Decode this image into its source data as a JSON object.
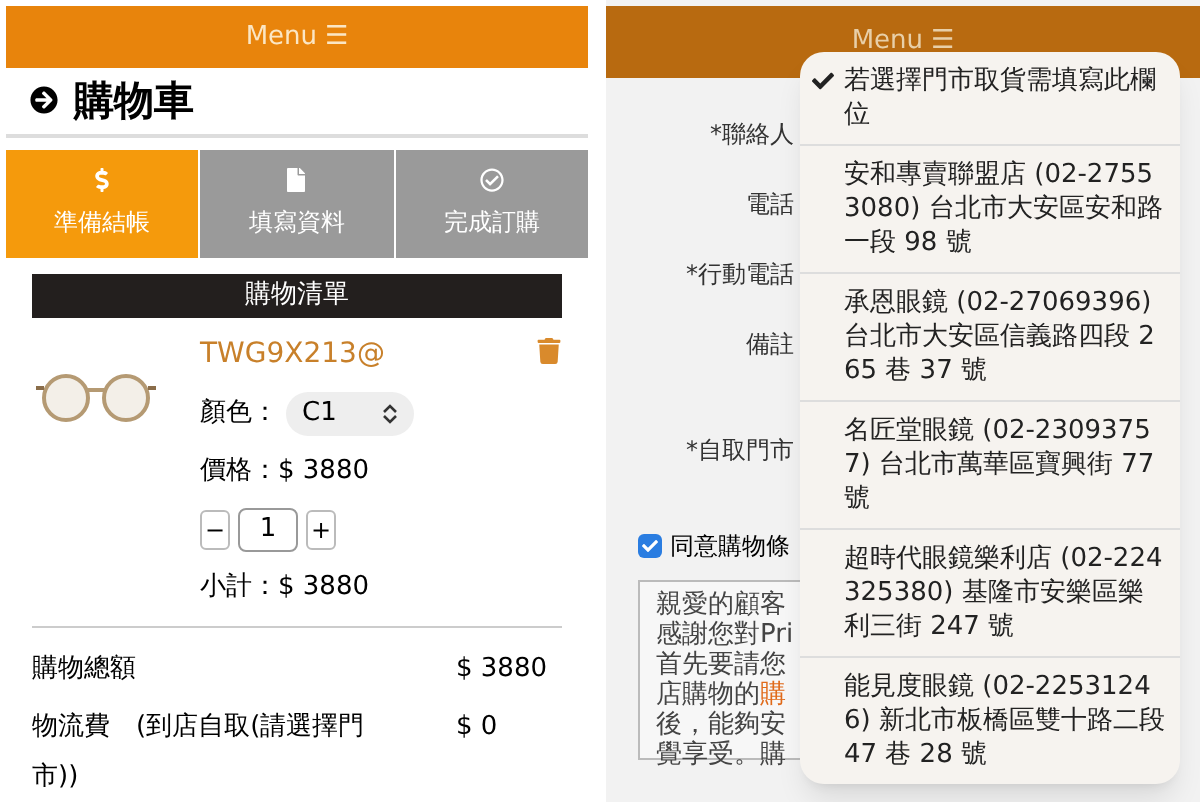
{
  "left": {
    "menu": {
      "label": "Menu",
      "icon": "☰"
    },
    "title": "購物車",
    "steps": [
      {
        "label": "準備結帳",
        "selected": true
      },
      {
        "label": "填寫資料",
        "selected": false
      },
      {
        "label": "完成訂購",
        "selected": false
      }
    ],
    "list_title": "購物清單",
    "product": {
      "name": "TWG9X213@",
      "color_label": "顏色：",
      "color_value": "C1",
      "price": "價格：$ 3880",
      "quantity": "1",
      "minus": "−",
      "plus": "+",
      "subtotal": "小計：$ 3880"
    },
    "totals": [
      {
        "label": "購物總額",
        "value": "$ 3880"
      },
      {
        "label": "物流費　(到店自取(請選擇門市))",
        "value": "$ 0"
      }
    ]
  },
  "right": {
    "menu": {
      "label": "Menu",
      "icon": "☰"
    },
    "fields": [
      {
        "label": "*聯絡人"
      },
      {
        "label": "電話"
      },
      {
        "label": "*行動電話"
      },
      {
        "label": "備註"
      },
      {
        "label": "*自取門市"
      }
    ],
    "agree": {
      "label": "同意購物條",
      "checked": true
    },
    "terms": [
      {
        "text": "親愛的顧客"
      },
      {
        "text": "感謝您對Pri"
      },
      {
        "text": "首先要請您"
      },
      {
        "text": "店購物的",
        "emphasis": "購"
      },
      {
        "text": "後，能夠安"
      },
      {
        "text": "覺享受。購"
      }
    ],
    "store_options": [
      {
        "label": "若選擇門市取貨需填寫此欄位",
        "selected": true
      },
      {
        "label": "安和專賣聯盟店 (02-27553080) 台北市大安區安和路一段 98 號",
        "selected": false
      },
      {
        "label": "承恩眼鏡 (02-27069396) 台北市大安區信義路四段 265 巷 37 號",
        "selected": false
      },
      {
        "label": "名匠堂眼鏡 (02-23093757) 台北市萬華區寶興街 77 號",
        "selected": false
      },
      {
        "label": "超時代眼鏡樂利店 (02-224325380) 基隆市安樂區樂利三街 247 號",
        "selected": false
      },
      {
        "label": "能見度眼鏡 (02-22531246) 新北市板橋區雙十路二段 47 巷 28 號",
        "selected": false
      }
    ]
  }
}
